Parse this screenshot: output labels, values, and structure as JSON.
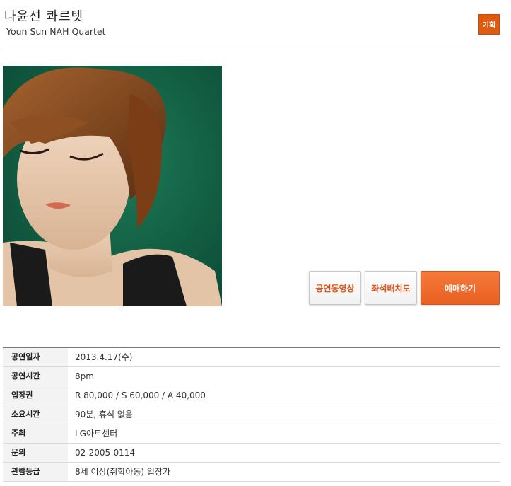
{
  "header": {
    "title": "나윤선 콰르텟",
    "subtitle": "Youn Sun NAH Quartet",
    "badge": "기획"
  },
  "poster": {
    "icon": "performer-photo"
  },
  "actions": {
    "video_label": "공연동영상",
    "seat_label": "좌석배치도",
    "book_label": "예매하기"
  },
  "info": {
    "rows": [
      {
        "label": "공연일자",
        "value": "2013.4.17(수)"
      },
      {
        "label": "공연시간",
        "value": "8pm"
      },
      {
        "label": "입장권",
        "value": "R 80,000 / S 60,000 / A 40,000"
      },
      {
        "label": "소요시간",
        "value": "90분, 휴식 없음"
      },
      {
        "label": "주최",
        "value": "LG아트센터"
      },
      {
        "label": "문의",
        "value": "02-2005-0114"
      },
      {
        "label": "관람등급",
        "value": "8세 이상(취학아동) 입장가"
      }
    ]
  },
  "colors": {
    "accent": "#e9601f",
    "badge": "#e05a10",
    "poster_bg": "#0f5a3e"
  }
}
